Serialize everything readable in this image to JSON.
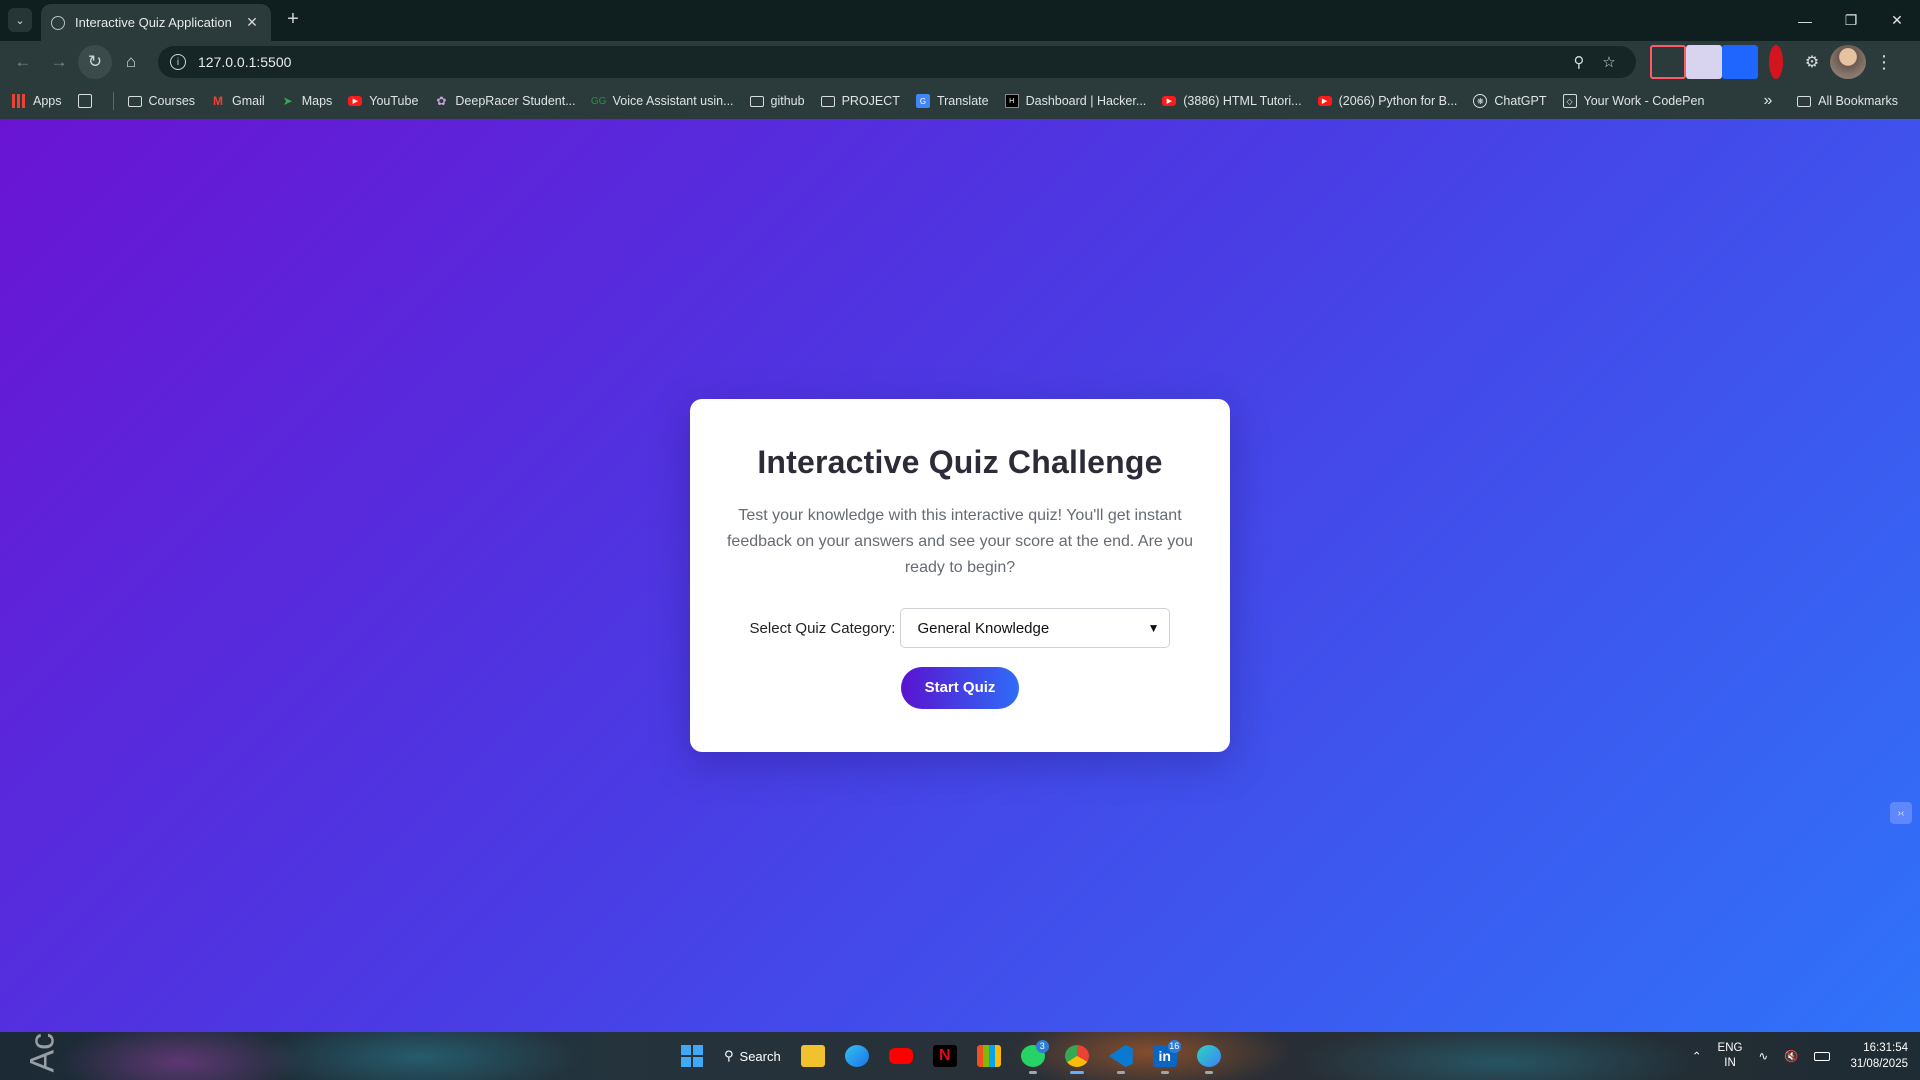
{
  "browser": {
    "tab_title": "Interactive Quiz Application",
    "url": "127.0.0.1:5500",
    "bookmarks": [
      {
        "label": "Apps",
        "icon": "apps-grid-icon"
      },
      {
        "label": "Courses",
        "icon": "folder-icon"
      },
      {
        "label": "Gmail",
        "icon": "gmail-icon"
      },
      {
        "label": "Maps",
        "icon": "maps-icon"
      },
      {
        "label": "YouTube",
        "icon": "youtube-icon"
      },
      {
        "label": "DeepRacer Student...",
        "icon": "deepracer-icon"
      },
      {
        "label": "Voice Assistant usin...",
        "icon": "gfg-icon"
      },
      {
        "label": "github",
        "icon": "folder-icon"
      },
      {
        "label": "PROJECT",
        "icon": "folder-icon"
      },
      {
        "label": "Translate",
        "icon": "translate-icon"
      },
      {
        "label": "Dashboard | Hacker...",
        "icon": "hackerrank-icon"
      },
      {
        "label": "(3886) HTML Tutori...",
        "icon": "youtube-icon"
      },
      {
        "label": "(2066) Python for B...",
        "icon": "youtube-icon"
      },
      {
        "label": "ChatGPT",
        "icon": "chatgpt-icon"
      },
      {
        "label": "Your Work - CodePen",
        "icon": "codepen-icon"
      }
    ],
    "all_bookmarks_label": "All Bookmarks"
  },
  "quiz": {
    "title": "Interactive Quiz Challenge",
    "description": "Test your knowledge with this interactive quiz! You'll get instant feedback on your answers and see your score at the end. Are you ready to begin?",
    "category_label": "Select Quiz Category:",
    "category_selected": "General Knowledge",
    "start_label": "Start Quiz"
  },
  "taskbar": {
    "search_label": "Search",
    "watermark": "Ac",
    "whatsapp_badge": "3",
    "linkedin_badge": "16",
    "language": "ENG",
    "region": "IN",
    "time": "16:31:54",
    "date": "31/08/2025"
  },
  "colors": {
    "gradient_start": "#6a14d3",
    "gradient_end": "#2f73f9",
    "button_start": "#5a13cf",
    "button_end": "#2f6cf8"
  }
}
